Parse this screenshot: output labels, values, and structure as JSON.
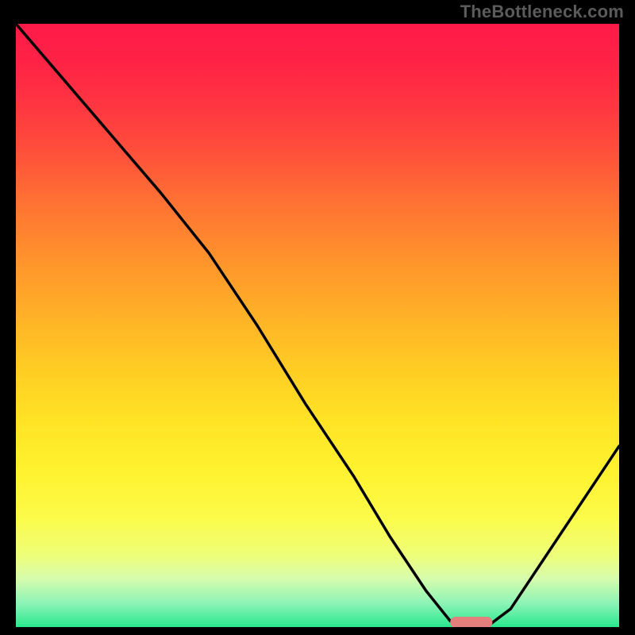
{
  "attribution": "TheBottleneck.com",
  "colors": {
    "background": "#000000",
    "gradient_stops": [
      {
        "offset": 0.0,
        "color": "#ff1a48"
      },
      {
        "offset": 0.06,
        "color": "#ff2246"
      },
      {
        "offset": 0.12,
        "color": "#ff3142"
      },
      {
        "offset": 0.2,
        "color": "#ff4b3c"
      },
      {
        "offset": 0.3,
        "color": "#ff7333"
      },
      {
        "offset": 0.4,
        "color": "#ff962b"
      },
      {
        "offset": 0.5,
        "color": "#ffb626"
      },
      {
        "offset": 0.58,
        "color": "#ffcf23"
      },
      {
        "offset": 0.66,
        "color": "#ffe326"
      },
      {
        "offset": 0.74,
        "color": "#fff22f"
      },
      {
        "offset": 0.82,
        "color": "#fbfb49"
      },
      {
        "offset": 0.88,
        "color": "#eefe78"
      },
      {
        "offset": 0.92,
        "color": "#d6fcac"
      },
      {
        "offset": 0.96,
        "color": "#8ef4b6"
      },
      {
        "offset": 1.0,
        "color": "#28e88e"
      }
    ],
    "curve": "#000000",
    "marker_fill": "#e37f7c",
    "marker_stroke": "#d46f6c"
  },
  "chart_data": {
    "type": "line",
    "title": "",
    "xlabel": "",
    "ylabel": "",
    "xlim": [
      0,
      100
    ],
    "ylim": [
      0,
      100
    ],
    "series": [
      {
        "name": "bottleneck-curve",
        "x": [
          0,
          6,
          12,
          18,
          24,
          28,
          32,
          40,
          48,
          56,
          62,
          68,
          72,
          74,
          78,
          82,
          86,
          90,
          94,
          98,
          100
        ],
        "y": [
          100,
          93,
          86,
          79,
          72,
          67,
          62,
          50,
          37,
          25,
          15,
          6,
          1,
          0,
          0,
          3,
          9,
          15,
          21,
          27,
          30
        ]
      }
    ],
    "marker": {
      "x_start": 72,
      "x_end": 79,
      "y": 0
    }
  }
}
